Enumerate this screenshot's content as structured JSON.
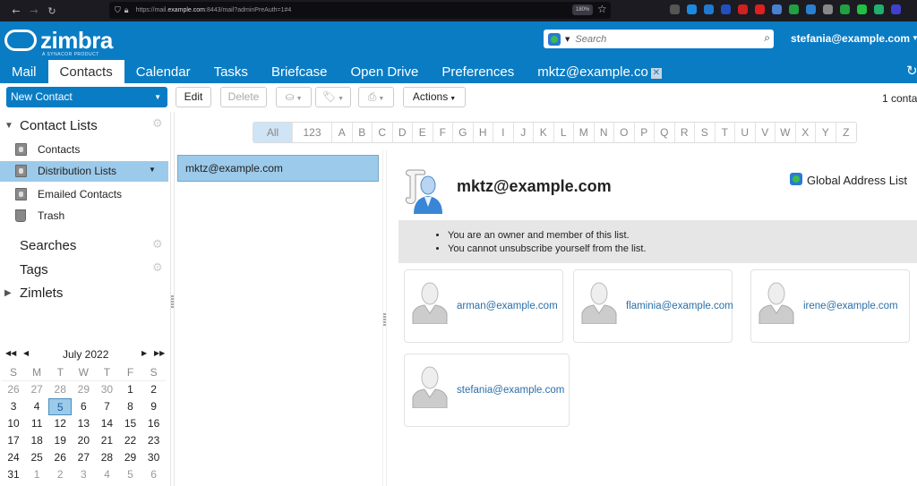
{
  "browser": {
    "url_prefix": "https://mail.",
    "url_domain": "example.com",
    "url_suffix": ":8443/mail?adminPreAuth=1#4",
    "zoom": "180%",
    "extension_colors": [
      "#555",
      "#1a8ae0",
      "#1e7ad0",
      "#2050c0",
      "#d02020",
      "#e02020",
      "#4a80d0",
      "#20a040",
      "#2a80d0",
      "#888",
      "#20a040",
      "#20c040",
      "#20b070",
      "#4040d0"
    ]
  },
  "header": {
    "logo_text": "zimbra",
    "logo_sub": "A SYNACOR PRODUCT",
    "search_placeholder": "Search",
    "user": "stefania@example.com",
    "tabs": [
      {
        "label": "Mail"
      },
      {
        "label": "Contacts",
        "active": true
      },
      {
        "label": "Calendar"
      },
      {
        "label": "Tasks"
      },
      {
        "label": "Briefcase"
      },
      {
        "label": "Open Drive"
      },
      {
        "label": "Preferences"
      },
      {
        "label": "mktz@example.co",
        "closable": true
      }
    ],
    "close_glyph": "✕"
  },
  "toolbar": {
    "new_contact": "New Contact",
    "edit": "Edit",
    "delete": "Delete",
    "actions": "Actions",
    "count": "1 conta"
  },
  "sidebar": {
    "contact_lists": "Contact Lists",
    "items": [
      {
        "label": "Contacts"
      },
      {
        "label": "Distribution Lists",
        "selected": true
      },
      {
        "label": "Emailed Contacts"
      },
      {
        "label": "Trash"
      }
    ],
    "searches": "Searches",
    "tags": "Tags",
    "zimlets": "Zimlets"
  },
  "calendar": {
    "month": "July 2022",
    "dow": [
      "S",
      "M",
      "T",
      "W",
      "T",
      "F",
      "S"
    ],
    "weeks": [
      [
        [
          "26",
          1
        ],
        [
          "27",
          1
        ],
        [
          "28",
          1
        ],
        [
          "29",
          1
        ],
        [
          "30",
          1
        ],
        [
          "1",
          0
        ],
        [
          "2",
          0
        ]
      ],
      [
        [
          "3",
          0
        ],
        [
          "4",
          0
        ],
        [
          "5",
          2
        ],
        [
          "6",
          0
        ],
        [
          "7",
          0
        ],
        [
          "8",
          0
        ],
        [
          "9",
          0
        ]
      ],
      [
        [
          "10",
          0
        ],
        [
          "11",
          0
        ],
        [
          "12",
          0
        ],
        [
          "13",
          0
        ],
        [
          "14",
          0
        ],
        [
          "15",
          0
        ],
        [
          "16",
          0
        ]
      ],
      [
        [
          "17",
          0
        ],
        [
          "18",
          0
        ],
        [
          "19",
          0
        ],
        [
          "20",
          0
        ],
        [
          "21",
          0
        ],
        [
          "22",
          0
        ],
        [
          "23",
          0
        ]
      ],
      [
        [
          "24",
          0
        ],
        [
          "25",
          0
        ],
        [
          "26",
          0
        ],
        [
          "27",
          0
        ],
        [
          "28",
          0
        ],
        [
          "29",
          0
        ],
        [
          "30",
          0
        ]
      ],
      [
        [
          "31",
          0
        ],
        [
          "1",
          1
        ],
        [
          "2",
          1
        ],
        [
          "3",
          1
        ],
        [
          "4",
          1
        ],
        [
          "5",
          1
        ],
        [
          "6",
          1
        ]
      ]
    ]
  },
  "alpha": [
    "All",
    "123",
    "A",
    "B",
    "C",
    "D",
    "E",
    "F",
    "G",
    "H",
    "I",
    "J",
    "K",
    "L",
    "M",
    "N",
    "O",
    "P",
    "Q",
    "R",
    "S",
    "T",
    "U",
    "V",
    "W",
    "X",
    "Y",
    "Z"
  ],
  "list": {
    "selected": "mktz@example.com"
  },
  "detail": {
    "title": "mktz@example.com",
    "source": "Global Address List",
    "notices": [
      "You are an owner and member of this list.",
      "You cannot unsubscribe yourself from the list."
    ],
    "members": [
      "arman@example.com",
      "flaminia@example.com",
      "irene@example.com",
      "stefania@example.com"
    ]
  }
}
